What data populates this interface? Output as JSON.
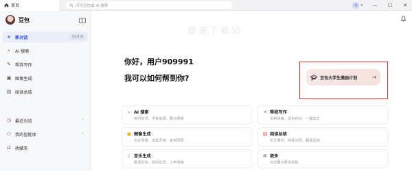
{
  "topbar": {
    "tab_label": "首页",
    "search_placeholder": "问问豆包或 AI 搜索",
    "avatar_text": "a"
  },
  "sidebar": {
    "brand": "豆包",
    "items": [
      {
        "label": "新对话",
        "icon": "plus-icon",
        "shortcut": "Ctrl K"
      },
      {
        "label": "AI 搜索",
        "icon": "search-icon"
      },
      {
        "label": "帮我写作",
        "icon": "pen-icon"
      },
      {
        "label": "图像生成",
        "icon": "image-icon"
      },
      {
        "label": "阅读总结",
        "icon": "book-icon"
      }
    ],
    "items2": [
      {
        "label": "最近对话",
        "icon": "clock-icon"
      },
      {
        "label": "我的智能体",
        "icon": "agent-icon"
      },
      {
        "label": "收藏夹",
        "icon": "bookmark-icon"
      }
    ]
  },
  "main": {
    "watermark": "极速下载站",
    "greeting": "你好，用户909991",
    "subgreeting": "我可以如何帮到你?",
    "promo": {
      "label": "豆包大学生激励计划",
      "icon": "graduation-cap-icon"
    },
    "cards": [
      {
        "title": "AI 搜索",
        "desc": "实时资讯、丰富信源、整合搜索",
        "icon": "search-icon",
        "color": "#2f8fe0"
      },
      {
        "title": "帮我写作",
        "desc": "多种体裁、润色校对、一键成文",
        "icon": "shuffle-icon",
        "color": "#39b36a"
      },
      {
        "title": "图像生成",
        "desc": "自定风格、搜集灵感、复刻同款",
        "icon": "palette-icon",
        "color": "#f2b51f"
      },
      {
        "title": "阅读总结",
        "desc": "论文课件、财报合同、翻译总结",
        "icon": "document-icon",
        "color": "#e64a3b"
      },
      {
        "title": "音乐生成",
        "desc": "歌词定制、曲风任选、人声演唱",
        "icon": "music-icon",
        "color": "#8a58e6"
      },
      {
        "title": "更多",
        "desc": "点击展示更多技能",
        "icon": "grid-icon",
        "color": "#5b6378"
      }
    ]
  }
}
